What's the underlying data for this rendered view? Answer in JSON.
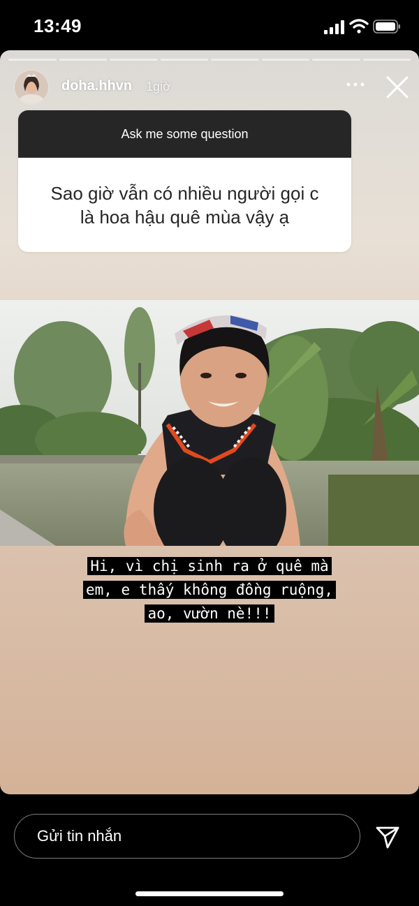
{
  "status": {
    "time": "13:49"
  },
  "header": {
    "username": "doha.hhvn",
    "time_ago": "1giờ"
  },
  "question_box": {
    "title": "Ask me some question",
    "question_lines": [
      "Sao giờ vẫn có nhiều người gọi c",
      "là hoa hậu quê mùa vậy ạ"
    ]
  },
  "caption": {
    "lines": [
      "Hi, vì chị sinh ra ở quê mà",
      "em, e thấy không đồng ruộng,",
      "ao, vườn nè!!!"
    ]
  },
  "composer": {
    "placeholder": "Gửi tin nhắn"
  },
  "icons": {
    "signal": "signal-icon",
    "wifi": "wifi-icon",
    "battery": "battery-icon",
    "more": "more-icon",
    "close": "close-icon",
    "send": "send-icon"
  }
}
